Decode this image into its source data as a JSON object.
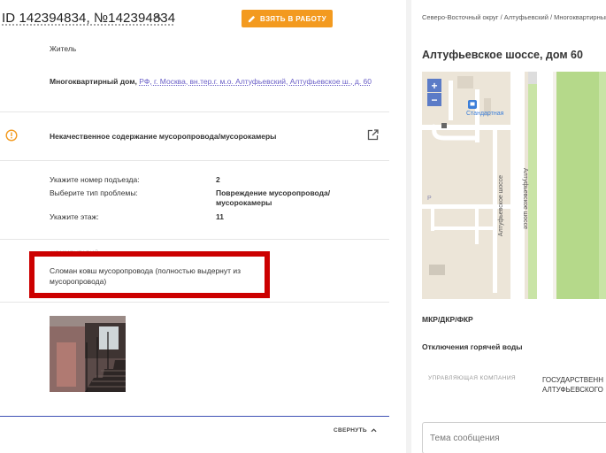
{
  "header": {
    "title": "ID 142394834, №142394834",
    "take_button": "ВЗЯТЬ В РАБОТУ"
  },
  "applicant": {
    "type": "Житель",
    "address_prefix": "Многоквартирный дом, ",
    "address_link": "РФ, г. Москва, вн.тер.г. м.о. Алтуфьевский, Алтуфьевское ш., д. 60"
  },
  "problem": {
    "title": "Некачественное содержание мусоропровода/мусорокамеры",
    "fields": [
      {
        "label": "Укажите номер подъезда:",
        "value": "2"
      },
      {
        "label": "Выберите тип проблемы:",
        "value": "Повреждение мусоропровода/ мусорокамеры"
      },
      {
        "label": "Укажите этаж:",
        "value": "11"
      }
    ],
    "comment_label": "КОММЕНТАРИЙ",
    "comment": "Сломан ковш мусоропровода (полностью выдернут из мусоропровода)"
  },
  "footer": {
    "collapse_label": "СВЕРНУТЬ"
  },
  "right": {
    "breadcrumb": "Северо-Восточный округ / Алтуфьевский / Многоквартирный дом",
    "street_title": "Алтуфьевское шоссе, дом 60",
    "map": {
      "zoom_in": "+",
      "zoom_out": "−",
      "station_label": "Стандартная",
      "street_label_1": "Алтуфьевское шоссе",
      "street_label_2": "Алтуфьевское шоссе",
      "poi_p": "P"
    },
    "mkr_label": "МКР/ДКР/ФКР",
    "hot_water_label": "Отключения горячей воды",
    "uk_label": "УПРАВЛЯЮЩАЯ КОМПАНИЯ",
    "uk_value_1": "ГОСУДАРСТВЕНН",
    "uk_value_2": "АЛТУФЬЕВСКОГО",
    "message_placeholder": "Тема сообщения"
  },
  "colors": {
    "accent_orange": "#f39a1f",
    "link_purple": "#6a5fc7",
    "highlight_red": "#cc0000",
    "line_blue": "#3f51b5",
    "map_green": "#b5d98a"
  }
}
